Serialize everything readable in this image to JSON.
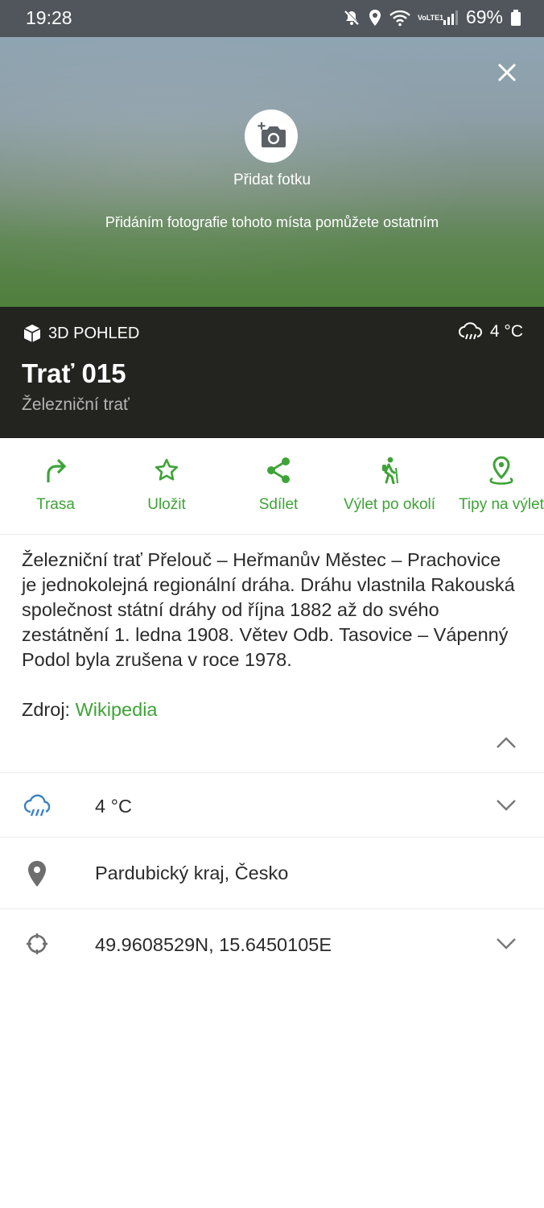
{
  "status_bar": {
    "time": "19:28",
    "battery": "69%",
    "network_badge": "VoLTE1",
    "icons": [
      "mute-icon",
      "location-icon",
      "wifi-icon",
      "signal-icon",
      "battery-icon"
    ]
  },
  "hero": {
    "add_photo_label": "Přidat fotku",
    "hint": "Přidáním fotografie tohoto místa pomůžete ostatním"
  },
  "header": {
    "view3d_label": "3D POHLED",
    "weather": "4 °C",
    "title": "Trať 015",
    "subtitle": "Železniční trať"
  },
  "actions": [
    {
      "label": "Trasa",
      "icon": "route-arrow-icon"
    },
    {
      "label": "Uložit",
      "icon": "star-icon"
    },
    {
      "label": "Sdílet",
      "icon": "share-icon"
    },
    {
      "label": "Výlet po okolí",
      "icon": "hiker-icon"
    },
    {
      "label": "Tipy na výlet",
      "icon": "map-pin-icon"
    }
  ],
  "description": {
    "text": "Železniční trať Přelouč – Heřmanův Městec – Prachovice je jednokolejná regionální dráha. Dráhu vlastnila Rakouská společnost státní dráhy od října 1882 až do svého zestátnění 1. ledna 1908. Větev Odb. Tasovice – Vápenný Podol byla zrušena v roce 1978.",
    "source_prefix": "Zdroj: ",
    "source_link": "Wikipedia"
  },
  "info": {
    "weather": "4 °C",
    "region": "Pardubický kraj, Česko",
    "coordinates": "49.9608529N, 15.6450105E"
  },
  "colors": {
    "accent_green": "#3ea337",
    "weather_blue": "#3b82c4",
    "header_dark": "#232320",
    "status_bar": "#50565c"
  }
}
